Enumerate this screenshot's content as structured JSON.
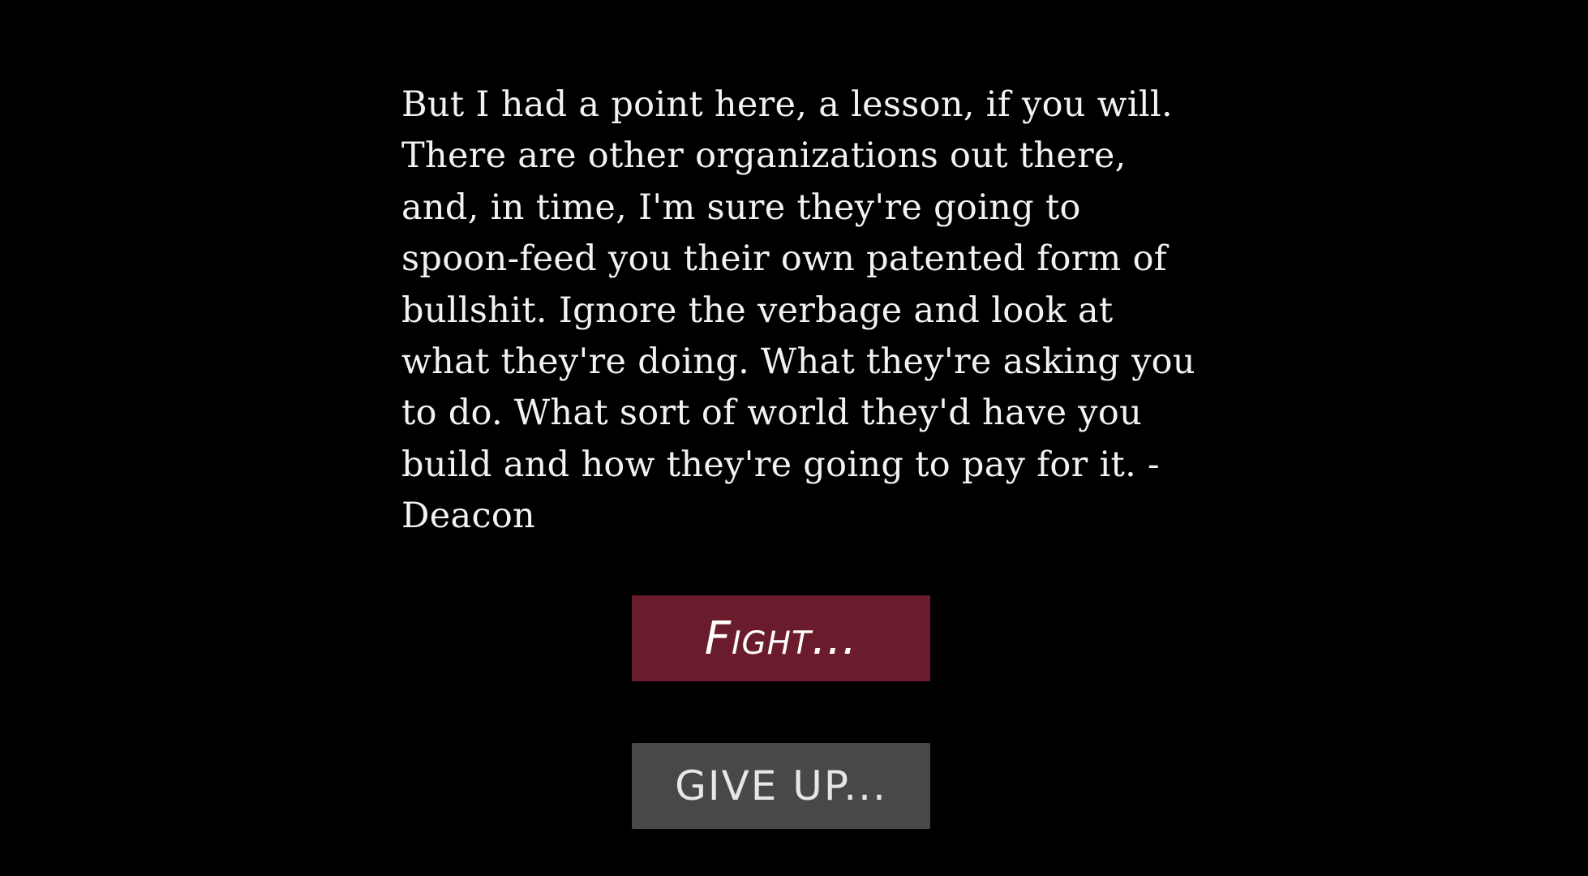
{
  "quote": {
    "text": "But I had a point here, a lesson, if you will.\nThere are other organizations out there,\nand, in time, I'm sure they're going to\nspoon-feed you their own patented form of\nbullshit. Ignore the verbage and look at\nwhat they're doing. What they're asking you\nto do. What sort of world they'd have you\nbuild and how they're going to pay for it. -\nDeacon"
  },
  "buttons": {
    "fight_label": "Fight...",
    "give_up_label": "GIVE UP..."
  },
  "colors": {
    "background": "#000000",
    "text": "#f2f2f2",
    "fight_button": "#6b1c2c",
    "give_up_button": "#484848"
  }
}
